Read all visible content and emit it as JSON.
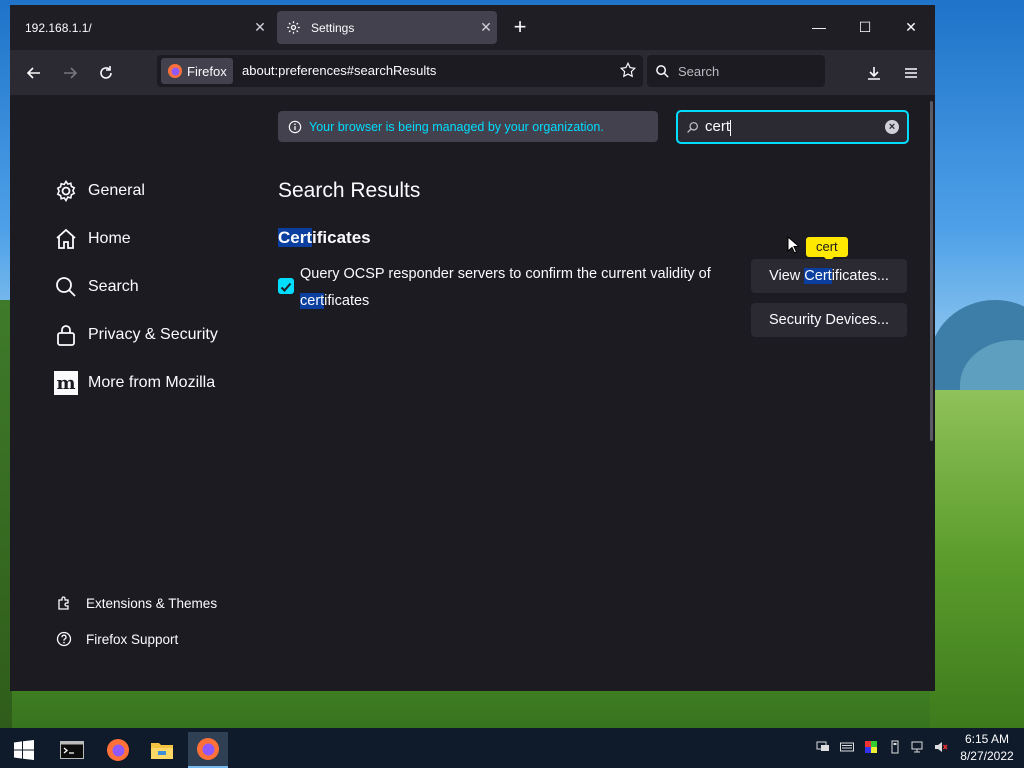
{
  "browser": {
    "tabs": [
      {
        "title": "192.168.1.1/",
        "close": "✕"
      },
      {
        "title": "Settings",
        "close": "✕"
      }
    ],
    "new_tab_label": "+",
    "window_controls": {
      "minimize": "—",
      "maximize": "☐",
      "close": "✕"
    },
    "identity_label": "Firefox",
    "url": "about:preferences#searchResults",
    "search_placeholder": "Search"
  },
  "preferences": {
    "managed_notice": "Your browser is being managed by your organization.",
    "find_value": "cert",
    "categories": [
      {
        "label": "General",
        "icon": "gear-icon"
      },
      {
        "label": "Home",
        "icon": "home-icon"
      },
      {
        "label": "Search",
        "icon": "search-icon"
      },
      {
        "label": "Privacy & Security",
        "icon": "lock-icon"
      },
      {
        "label": "More from Mozilla",
        "icon": "mozilla-icon"
      }
    ],
    "footer_links": [
      {
        "label": "Extensions & Themes",
        "icon": "puzzle-icon"
      },
      {
        "label": "Firefox Support",
        "icon": "help-icon"
      }
    ],
    "results_heading": "Search Results",
    "group_title": {
      "highlight": "Cert",
      "rest": "ificates"
    },
    "ocsp_checkbox": {
      "checked": true,
      "text_line1": "Query OCSP responder servers to confirm the current validity of",
      "text_line2_highlight": "cert",
      "text_line2_rest": "ificates"
    },
    "view_certs_button": {
      "pre": "View ",
      "highlight": "Cert",
      "rest": "ificates..."
    },
    "security_devices_button": "Security Devices...",
    "tooltip": "cert"
  },
  "taskbar": {
    "time": "6:15 AM",
    "date": "8/27/2022",
    "apps": [
      "windows-start-icon",
      "terminal-icon",
      "firefox-icon",
      "file-explorer-icon",
      "firefox-icon"
    ]
  },
  "colors": {
    "accent": "#00ddff",
    "highlight": "#0b3f9f",
    "tooltip": "#ffe900",
    "page_bg": "#1c1b22"
  }
}
